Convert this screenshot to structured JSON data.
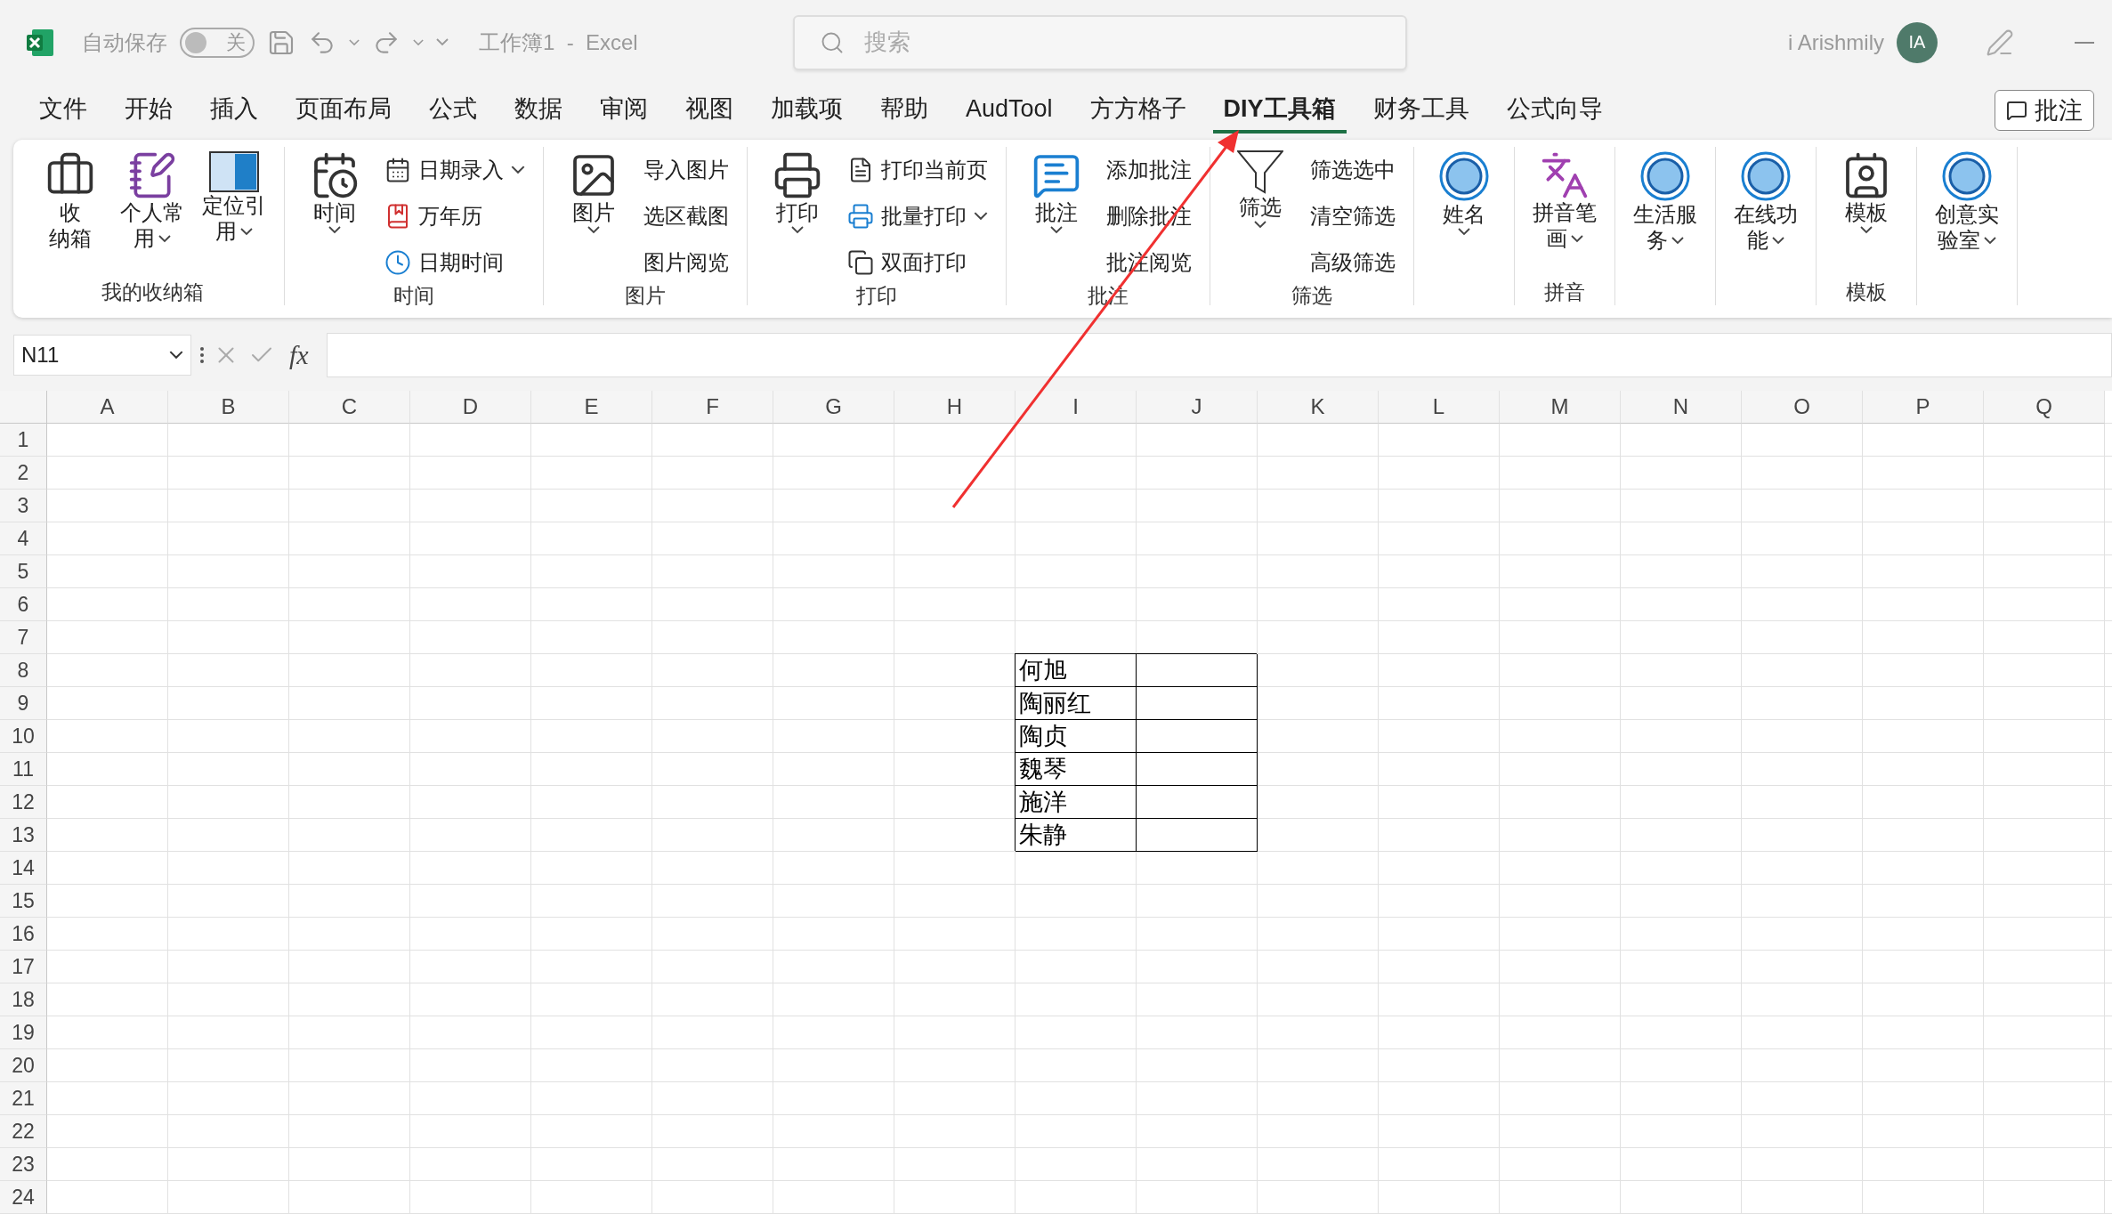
{
  "title_bar": {
    "autosave": {
      "label": "自动保存",
      "state_text": "关",
      "on": false
    },
    "document_title": "工作簿1  -  Excel",
    "search": {
      "placeholder": "搜索"
    },
    "user_name": "i Arishmily",
    "avatar_initials": "IA"
  },
  "tabs": [
    {
      "label": "文件",
      "selected": false
    },
    {
      "label": "开始",
      "selected": false
    },
    {
      "label": "插入",
      "selected": false
    },
    {
      "label": "页面布局",
      "selected": false
    },
    {
      "label": "公式",
      "selected": false
    },
    {
      "label": "数据",
      "selected": false
    },
    {
      "label": "审阅",
      "selected": false
    },
    {
      "label": "视图",
      "selected": false
    },
    {
      "label": "加载项",
      "selected": false
    },
    {
      "label": "帮助",
      "selected": false
    },
    {
      "label": "AudTool",
      "selected": false
    },
    {
      "label": "方方格子",
      "selected": false
    },
    {
      "label": "DIY工具箱",
      "selected": true
    },
    {
      "label": "财务工具",
      "selected": false
    },
    {
      "label": "公式向导",
      "selected": false
    }
  ],
  "comments_button": "批注",
  "ribbon": {
    "groups": [
      {
        "label": "我的收纳箱",
        "items": [
          {
            "kind": "large",
            "lines": [
              "收",
              "纳箱"
            ],
            "dropdown": false
          },
          {
            "kind": "large",
            "lines": [
              "个人常",
              "用"
            ],
            "dropdown": true
          },
          {
            "kind": "large",
            "lines": [
              "定位引",
              "用"
            ],
            "dropdown": true
          }
        ]
      },
      {
        "label": "时间",
        "items": [
          {
            "kind": "large",
            "lines": [
              "时间"
            ],
            "dropdown": true
          },
          {
            "kind": "small",
            "label": "日期录入",
            "dropdown": true
          },
          {
            "kind": "small",
            "label": "万年历",
            "dropdown": false
          },
          {
            "kind": "small",
            "label": "日期时间",
            "dropdown": false
          }
        ]
      },
      {
        "label": "图片",
        "items": [
          {
            "kind": "large",
            "lines": [
              "图片"
            ],
            "dropdown": true
          },
          {
            "kind": "small",
            "label": "导入图片",
            "dropdown": false
          },
          {
            "kind": "small",
            "label": "选区截图",
            "dropdown": false
          },
          {
            "kind": "small",
            "label": "图片阅览",
            "dropdown": false
          }
        ]
      },
      {
        "label": "打印",
        "items": [
          {
            "kind": "large",
            "lines": [
              "打印"
            ],
            "dropdown": true
          },
          {
            "kind": "small",
            "label": "打印当前页",
            "dropdown": false
          },
          {
            "kind": "small",
            "label": "批量打印",
            "dropdown": true
          },
          {
            "kind": "small",
            "label": "双面打印",
            "dropdown": false
          }
        ]
      },
      {
        "label": "批注",
        "items": [
          {
            "kind": "large",
            "lines": [
              "批注"
            ],
            "dropdown": true
          },
          {
            "kind": "small",
            "label": "添加批注",
            "dropdown": false
          },
          {
            "kind": "small",
            "label": "删除批注",
            "dropdown": false
          },
          {
            "kind": "small",
            "label": "批注阅览",
            "dropdown": false
          }
        ]
      },
      {
        "label": "筛选",
        "items": [
          {
            "kind": "large",
            "lines": [
              "筛选"
            ],
            "dropdown": true
          },
          {
            "kind": "small",
            "label": "筛选选中",
            "dropdown": false
          },
          {
            "kind": "small",
            "label": "清空筛选",
            "dropdown": false
          },
          {
            "kind": "small",
            "label": "高级筛选",
            "dropdown": false
          }
        ]
      },
      {
        "items": [
          {
            "kind": "large",
            "lines": [
              "姓名"
            ],
            "dropdown": true
          }
        ]
      },
      {
        "label": "拼音",
        "items": [
          {
            "kind": "large",
            "lines": [
              "拼音笔",
              "画"
            ],
            "dropdown": true
          }
        ]
      },
      {
        "items": [
          {
            "kind": "large",
            "lines": [
              "生活服",
              "务"
            ],
            "dropdown": true
          }
        ]
      },
      {
        "items": [
          {
            "kind": "large",
            "lines": [
              "在线功",
              "能"
            ],
            "dropdown": true
          }
        ]
      },
      {
        "label": "模板",
        "items": [
          {
            "kind": "large",
            "lines": [
              "模板"
            ],
            "dropdown": true
          }
        ]
      },
      {
        "items": [
          {
            "kind": "large",
            "lines": [
              "创意实",
              "验室"
            ],
            "dropdown": true
          }
        ]
      }
    ]
  },
  "formula_bar": {
    "name_box": "N11",
    "fx": "fx"
  },
  "sheet": {
    "columns": [
      "A",
      "B",
      "C",
      "D",
      "E",
      "F",
      "G",
      "H",
      "I",
      "J",
      "K",
      "L",
      "M",
      "N",
      "O",
      "P",
      "Q"
    ],
    "row_headers": [
      "1",
      "2",
      "3",
      "4",
      "5",
      "6",
      "7",
      "8",
      "9",
      "10",
      "11",
      "12",
      "13",
      "14",
      "15",
      "16",
      "17",
      "18",
      "19",
      "20",
      "21",
      "22",
      "23",
      "24"
    ],
    "names": [
      "何旭",
      "陶丽红",
      "陶贞",
      "魏琴",
      "施洋",
      "朱静"
    ]
  }
}
